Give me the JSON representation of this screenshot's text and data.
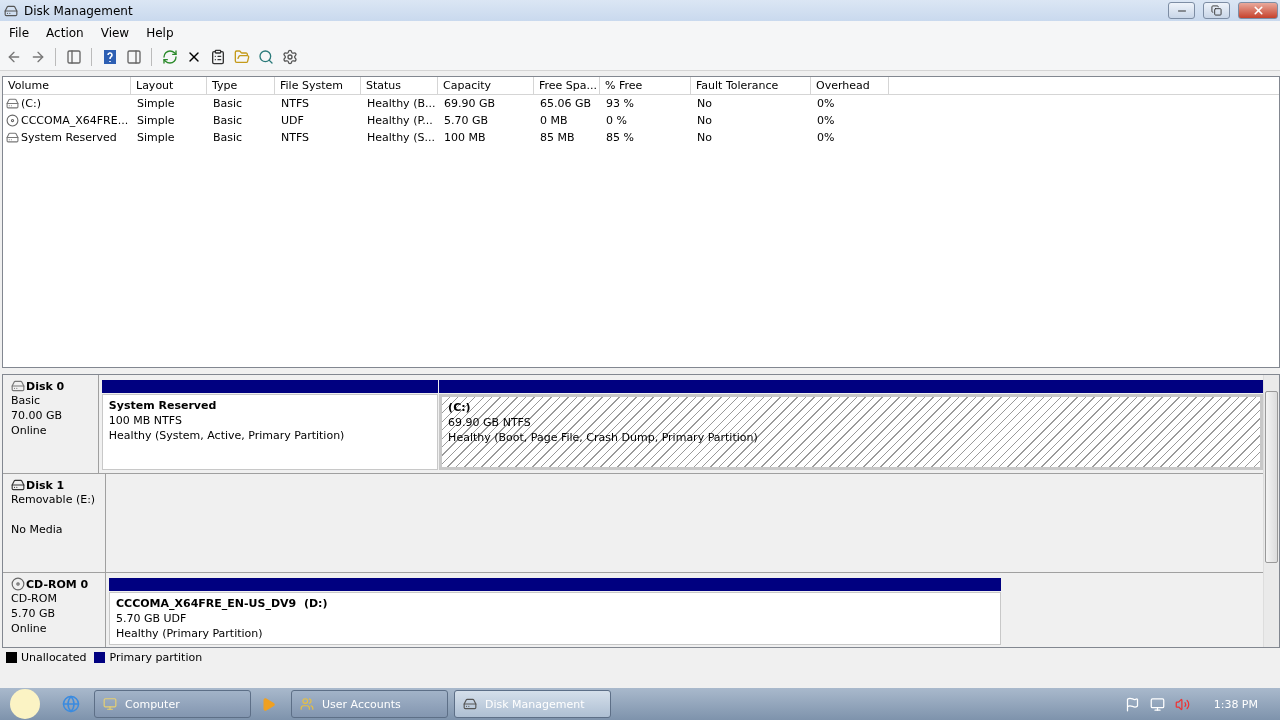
{
  "window": {
    "title": "Disk Management"
  },
  "menu": [
    "File",
    "Action",
    "View",
    "Help"
  ],
  "volume_table": {
    "columns": [
      "Volume",
      "Layout",
      "Type",
      "File System",
      "Status",
      "Capacity",
      "Free Spa...",
      "% Free",
      "Fault Tolerance",
      "Overhead"
    ],
    "rows": [
      {
        "kind": "hdd",
        "cells": [
          "(C:)",
          "Simple",
          "Basic",
          "NTFS",
          "Healthy (B...",
          "69.90 GB",
          "65.06 GB",
          "93 %",
          "No",
          "0%"
        ]
      },
      {
        "kind": "cd",
        "cells": [
          "CCCOMA_X64FRE...",
          "Simple",
          "Basic",
          "UDF",
          "Healthy (P...",
          "5.70 GB",
          "0 MB",
          "0 %",
          "No",
          "0%"
        ]
      },
      {
        "kind": "hdd",
        "cells": [
          "System Reserved",
          "Simple",
          "Basic",
          "NTFS",
          "Healthy (S...",
          "100 MB",
          "85 MB",
          "85 %",
          "No",
          "0%"
        ]
      }
    ]
  },
  "disks": [
    {
      "kind": "hdd",
      "name": "Disk 0",
      "lines": [
        "Basic",
        "70.00 GB",
        "Online"
      ],
      "partitions": [
        {
          "name": "System Reserved",
          "size": "100 MB NTFS",
          "status": "Healthy (System, Active, Primary Partition)",
          "selected": false
        },
        {
          "name": "(C:)",
          "size": "69.90 GB NTFS",
          "status": "Healthy (Boot, Page File, Crash Dump, Primary Partition)",
          "selected": true
        }
      ]
    },
    {
      "kind": "removable",
      "name": "Disk 1",
      "lines": [
        "Removable (E:)",
        "No Media"
      ]
    },
    {
      "kind": "cd",
      "name": "CD-ROM 0",
      "lines": [
        "CD-ROM",
        "5.70 GB",
        "Online"
      ],
      "partitions": [
        {
          "name": "CCCOMA_X64FRE_EN-US_DV9  (D:)",
          "size": "5.70 GB UDF",
          "status": "Healthy (Primary Partition)",
          "selected": false
        }
      ]
    }
  ],
  "legend": [
    {
      "label": "Unallocated",
      "color": "#000000"
    },
    {
      "label": "Primary partition",
      "color": "#000080"
    }
  ],
  "taskbar": {
    "buttons": [
      {
        "label": "Computer",
        "selected": false
      },
      {
        "label": "User Accounts",
        "selected": false
      },
      {
        "label": "Disk Management",
        "selected": true
      }
    ],
    "clock": "1:38 PM"
  }
}
